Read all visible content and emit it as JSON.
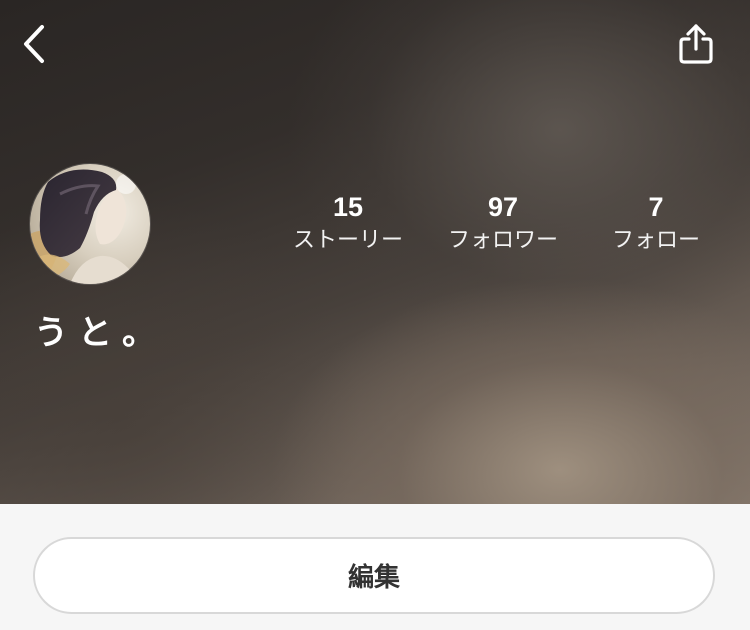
{
  "header": {
    "back_icon": "chevron-left-icon",
    "share_icon": "share-upload-icon"
  },
  "profile": {
    "username": "うと。",
    "avatar": "profile-avatar-illustration"
  },
  "stats": [
    {
      "count": "15",
      "label": "ストーリー"
    },
    {
      "count": "97",
      "label": "フォロワー"
    },
    {
      "count": "7",
      "label": "フォロー"
    }
  ],
  "actions": {
    "edit_label": "編集"
  },
  "colors": {
    "hero_dark": "#2a2624",
    "hero_light": "#8a7d71",
    "text_on_hero": "#ffffff",
    "bottom_bg": "#f6f6f6",
    "button_border": "#d8d8d8",
    "button_text": "#333333"
  }
}
